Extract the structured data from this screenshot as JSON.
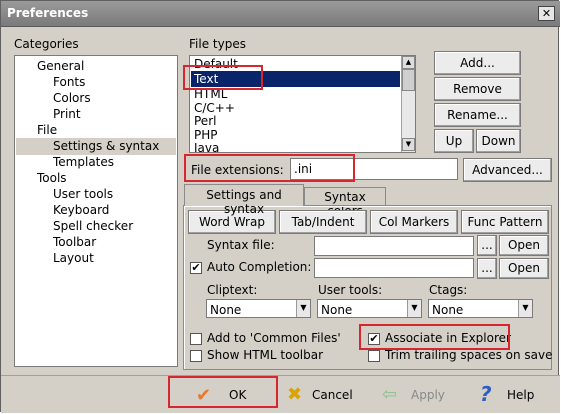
{
  "window": {
    "title": "Preferences",
    "close_label": "✕"
  },
  "categories": {
    "label": "Categories",
    "items": [
      {
        "label": "General"
      },
      {
        "label": "Fonts"
      },
      {
        "label": "Colors"
      },
      {
        "label": "Print"
      },
      {
        "label": "File"
      },
      {
        "label": "Settings & syntax"
      },
      {
        "label": "Templates"
      },
      {
        "label": "Tools"
      },
      {
        "label": "User tools"
      },
      {
        "label": "Keyboard"
      },
      {
        "label": "Spell checker"
      },
      {
        "label": "Toolbar"
      },
      {
        "label": "Layout"
      }
    ],
    "selected": "Settings & syntax"
  },
  "file_types": {
    "label": "File types",
    "items": [
      "Default",
      "Text",
      "HTML",
      "C/C++",
      "Perl",
      "PHP",
      "Java"
    ],
    "selected": "Text",
    "buttons": {
      "add": "Add...",
      "remove": "Remove",
      "rename": "Rename...",
      "up": "Up",
      "down": "Down"
    }
  },
  "file_extensions": {
    "label": "File extensions:",
    "value": ".ini",
    "advanced": "Advanced..."
  },
  "tabs": {
    "active": "Settings and syntax",
    "other": "Syntax colors"
  },
  "settings": {
    "toolbar_buttons": [
      "Word Wrap",
      "Tab/Indent",
      "Col Markers",
      "Func Pattern"
    ],
    "syntax_file_label": "Syntax file:",
    "syntax_file_value": "",
    "browse": "...",
    "open": "Open",
    "auto_completion_label": "Auto Completion:",
    "auto_completion_checked": "✔",
    "auto_completion_value": "",
    "cliptext_label": "Cliptext:",
    "cliptext_value": "None",
    "usertools_label": "User tools:",
    "usertools_value": "None",
    "ctags_label": "Ctags:",
    "ctags_value": "None",
    "add_common_files": "Add to 'Common Files'",
    "show_html_toolbar": "Show HTML toolbar",
    "associate_explorer": "Associate in Explorer",
    "associate_checked": "✔",
    "trim_spaces": "Trim trailing spaces on save"
  },
  "footer": {
    "ok": "OK",
    "cancel": "Cancel",
    "apply": "Apply",
    "help": "Help",
    "colors": {
      "ok_check": "#e8782a",
      "cancel_x": "#d9a400",
      "apply": "#8fbf8f",
      "help": "#2a5fc4"
    }
  },
  "colors": {
    "highlight": "#0a246a",
    "annotation": "#d7262e"
  }
}
